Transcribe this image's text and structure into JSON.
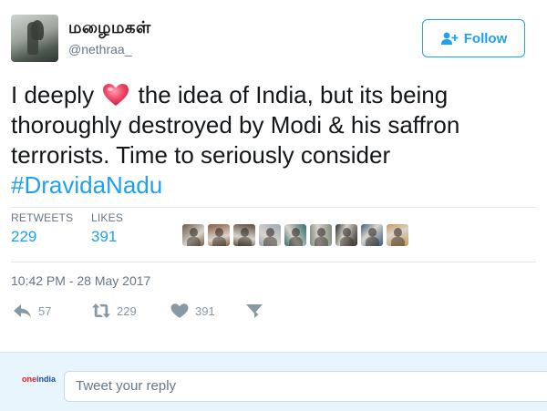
{
  "user": {
    "display_name": "மழைமகள்",
    "handle": "@nethraa_"
  },
  "follow_button": {
    "label": "Follow",
    "color": "#1da1f2"
  },
  "tweet": {
    "text_before_emoji": "I deeply",
    "emoji": "heart-icon",
    "text_after_emoji": " the idea of India, but its being thoroughly destroyed by Modi & his saffron terrorists. Time to seriously consider ",
    "hashtag": "#DravidaNadu"
  },
  "stats": {
    "retweets_label": "RETWEETS",
    "retweets_value": "229",
    "likes_label": "LIKES",
    "likes_value": "391"
  },
  "likers": [
    {
      "name": "liker-avatar-1",
      "color": "#6b5a43"
    },
    {
      "name": "liker-avatar-2",
      "color": "#8a5a3c"
    },
    {
      "name": "liker-avatar-3",
      "color": "#5a4a3a"
    },
    {
      "name": "liker-avatar-4",
      "color": "#9aa7b5"
    },
    {
      "name": "liker-avatar-5",
      "color": "#2f6b6a"
    },
    {
      "name": "liker-avatar-6",
      "color": "#7e8b7b"
    },
    {
      "name": "liker-avatar-7",
      "color": "#2b2b2b"
    },
    {
      "name": "liker-avatar-8",
      "color": "#3b5a7a"
    },
    {
      "name": "liker-avatar-9",
      "color": "#c79a5a"
    }
  ],
  "timestamp": "10:42 PM - 28 May 2017",
  "actions": {
    "reply_count": "57",
    "retweet_count": "229",
    "like_count": "391"
  },
  "reply": {
    "logo_text": "oneindia",
    "placeholder": "Tweet your reply"
  },
  "colors": {
    "accent": "#1da1f2",
    "muted": "#657786",
    "heart": "#e0245e"
  }
}
